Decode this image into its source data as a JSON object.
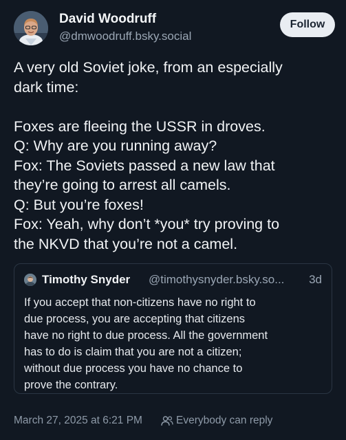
{
  "post": {
    "author_name": "David Woodruff",
    "author_handle": "@dmwoodruff.bsky.social",
    "follow_label": "Follow",
    "body_lines_intro": [
      "A very old Soviet joke, from an especially",
      "dark time:"
    ],
    "body_lines_joke": [
      "Foxes are fleeing the USSR in droves.",
      "Q: Why are you running away?",
      "Fox: The Soviets passed a new law that",
      "they’re going to arrest all camels.",
      "Q: But you’re foxes!",
      "Fox: Yeah, why don’t *you* try proving to",
      "the NKVD that you’re not a camel."
    ],
    "timestamp": "March 27, 2025 at 6:21 PM",
    "reply_setting": "Everybody can reply"
  },
  "quote": {
    "author_name": "Timothy Snyder",
    "author_handle": "@timothysnyder.bsky.so...",
    "age": "3d",
    "lines": [
      "If you accept that non-citizens have no right to",
      "due process, you are accepting that citizens",
      "have no right to due process. All the government",
      "has to do is claim that you are not a citizen;",
      "without due process you have no chance to",
      "prove the contrary."
    ]
  },
  "icons": {
    "avatar": "author-avatar-photo",
    "quote_avatar": "quote-author-avatar",
    "reply": "people-icon"
  },
  "colors": {
    "background": "#111822",
    "text": "#f1f3f5",
    "muted": "#9aa6b4",
    "follow_button": "#e9edf2",
    "quote_border": "#2b3644"
  }
}
